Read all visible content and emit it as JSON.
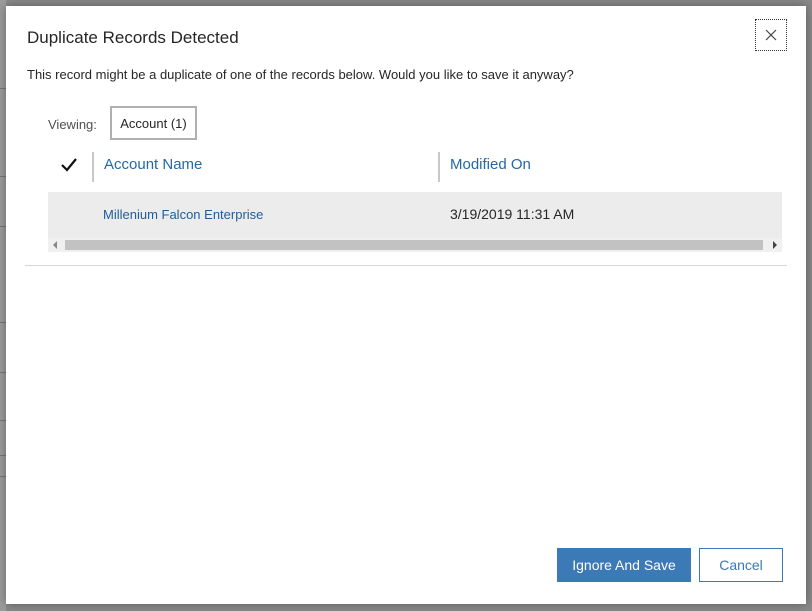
{
  "dialog": {
    "title": "Duplicate Records Detected",
    "message": "This record might be a duplicate of one of the records below. Would you like to save it anyway?",
    "close_icon": "close-icon"
  },
  "viewing": {
    "label": "Viewing:",
    "selected": "Account (1)"
  },
  "grid": {
    "select_all_icon": "checkmark-icon",
    "columns": [
      "Account Name",
      "Modified On"
    ],
    "rows": [
      {
        "account_name": "Millenium Falcon Enterprise",
        "modified_on": "3/19/2019 11:31 AM"
      }
    ]
  },
  "actions": {
    "primary": "Ignore And Save",
    "secondary": "Cancel"
  },
  "colors": {
    "accent": "#3b79b7",
    "link": "#1f5c9a",
    "row_bg": "#ececec"
  }
}
